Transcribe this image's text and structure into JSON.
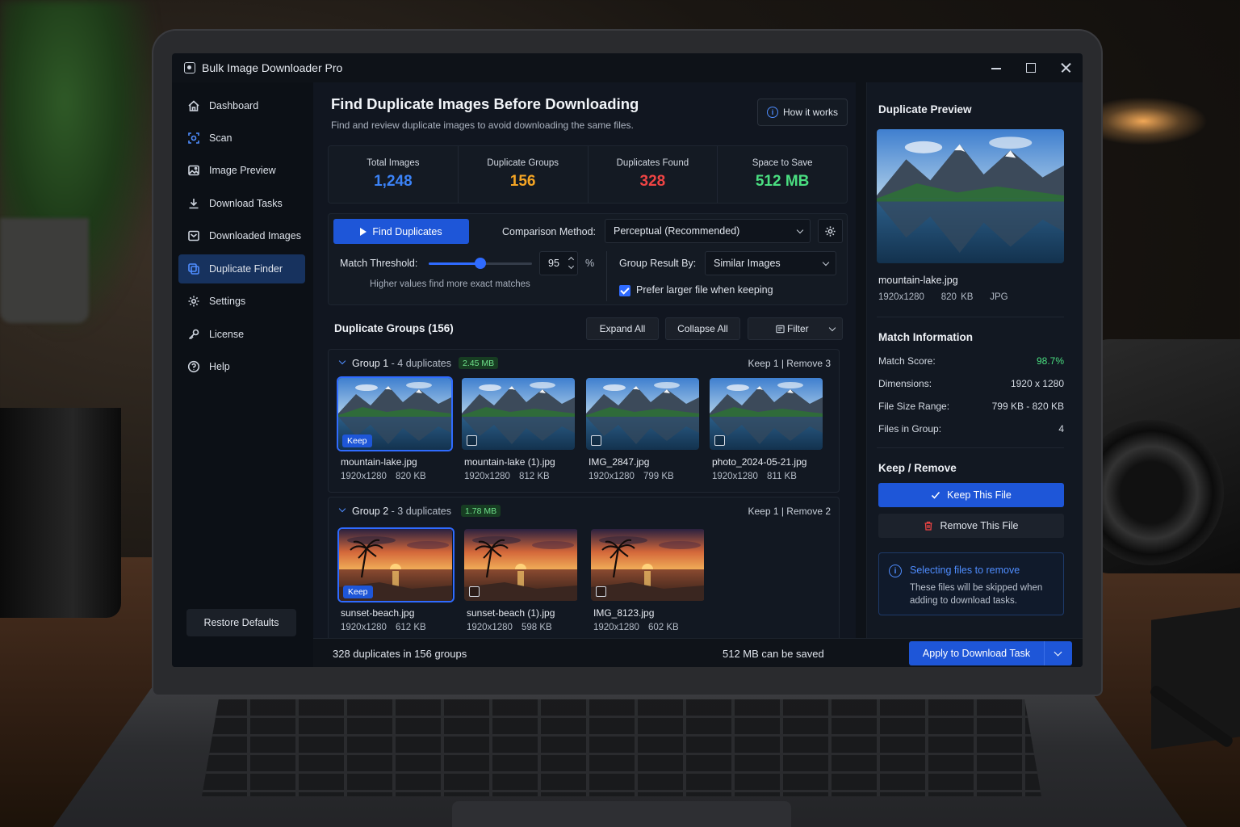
{
  "app": {
    "title": "Bulk Image Downloader Pro"
  },
  "sidebar": {
    "items": [
      {
        "label": "Dashboard",
        "icon": "home-icon"
      },
      {
        "label": "Scan",
        "icon": "scan-icon"
      },
      {
        "label": "Image Preview",
        "icon": "image-icon"
      },
      {
        "label": "Download Tasks",
        "icon": "download-icon"
      },
      {
        "label": "Downloaded Images",
        "icon": "inbox-icon"
      },
      {
        "label": "Duplicate Finder",
        "icon": "duplicate-icon",
        "active": true
      },
      {
        "label": "Settings",
        "icon": "gear-icon"
      },
      {
        "label": "License",
        "icon": "key-icon"
      },
      {
        "label": "Help",
        "icon": "help-icon"
      }
    ],
    "restore_label": "Restore Defaults"
  },
  "header": {
    "title": "Find Duplicate Images Before Downloading",
    "subtitle": "Find and review duplicate images to avoid downloading the same files.",
    "how_label": "How it works"
  },
  "stats": [
    {
      "label": "Total Images",
      "value": "1,248",
      "color": "#3b82f6"
    },
    {
      "label": "Duplicate Groups",
      "value": "156",
      "color": "#f5a524"
    },
    {
      "label": "Duplicates Found",
      "value": "328",
      "color": "#ef4444"
    },
    {
      "label": "Space to Save",
      "value": "512 MB",
      "color": "#4ade80"
    }
  ],
  "controls": {
    "find_label": "Find Duplicates",
    "comparison_label": "Comparison Method:",
    "comparison_value": "Perceptual (Recommended)",
    "threshold_label": "Match Threshold:",
    "threshold_value": "95",
    "threshold_fraction": 0.5,
    "threshold_unit": "%",
    "threshold_hint": "Higher values find more exact matches",
    "group_by_label": "Group Result By:",
    "group_by_value": "Similar Images",
    "prefer_larger_label": "Prefer larger file when keeping",
    "prefer_larger_checked": true
  },
  "groups_header": {
    "title": "Duplicate Groups (156)",
    "expand_label": "Expand All",
    "collapse_label": "Collapse All",
    "filter_label": "Filter"
  },
  "groups": [
    {
      "name": "Group 1",
      "count": "- 4 duplicates",
      "size": "2.45 MB",
      "keep_remove": "Keep 1 | Remove 3",
      "images": [
        {
          "file": "mountain-lake.jpg",
          "dims": "1920x1280",
          "size": "820 KB",
          "keep": true
        },
        {
          "file": "mountain-lake (1).jpg",
          "dims": "1920x1280",
          "size": "812 KB",
          "keep": false
        },
        {
          "file": "IMG_2847.jpg",
          "dims": "1920x1280",
          "size": "799 KB",
          "keep": false
        },
        {
          "file": "photo_2024-05-21.jpg",
          "dims": "1920x1280",
          "size": "811 KB",
          "keep": false
        }
      ]
    },
    {
      "name": "Group 2",
      "count": "- 3 duplicates",
      "size": "1.78 MB",
      "keep_remove": "Keep 1 | Remove 2",
      "images": [
        {
          "file": "sunset-beach.jpg",
          "dims": "1920x1280",
          "size": "612 KB",
          "keep": true
        },
        {
          "file": "sunset-beach (1).jpg",
          "dims": "1920x1280",
          "size": "598 KB",
          "keep": false
        },
        {
          "file": "IMG_8123.jpg",
          "dims": "1920x1280",
          "size": "602 KB",
          "keep": false
        }
      ]
    }
  ],
  "keep_badge": "Keep",
  "preview": {
    "title": "Duplicate Preview",
    "file": "mountain-lake.jpg",
    "dims": "1920x1280",
    "size": "820 KB",
    "format": "JPG"
  },
  "match_info": {
    "title": "Match Information",
    "rows": [
      {
        "label": "Match Score:",
        "value": "98.7%"
      },
      {
        "label": "Dimensions:",
        "value": "1920 x 1280"
      },
      {
        "label": "File Size Range:",
        "value": "799 KB - 820 KB"
      },
      {
        "label": "Files in Group:",
        "value": "4"
      }
    ]
  },
  "keep_remove": {
    "title": "Keep / Remove",
    "keep_label": "Keep This File",
    "remove_label": "Remove This File",
    "note_title": "Selecting files to remove",
    "note_text": "These files will be skipped when adding to download tasks."
  },
  "footer": {
    "left": "328 duplicates in 156 groups",
    "middle": "512 MB can be saved",
    "apply_label": "Apply to Download Task"
  },
  "colors": {
    "accent": "#1e56d8",
    "score": "#4ade80",
    "size_badge": "#6ee08a"
  }
}
